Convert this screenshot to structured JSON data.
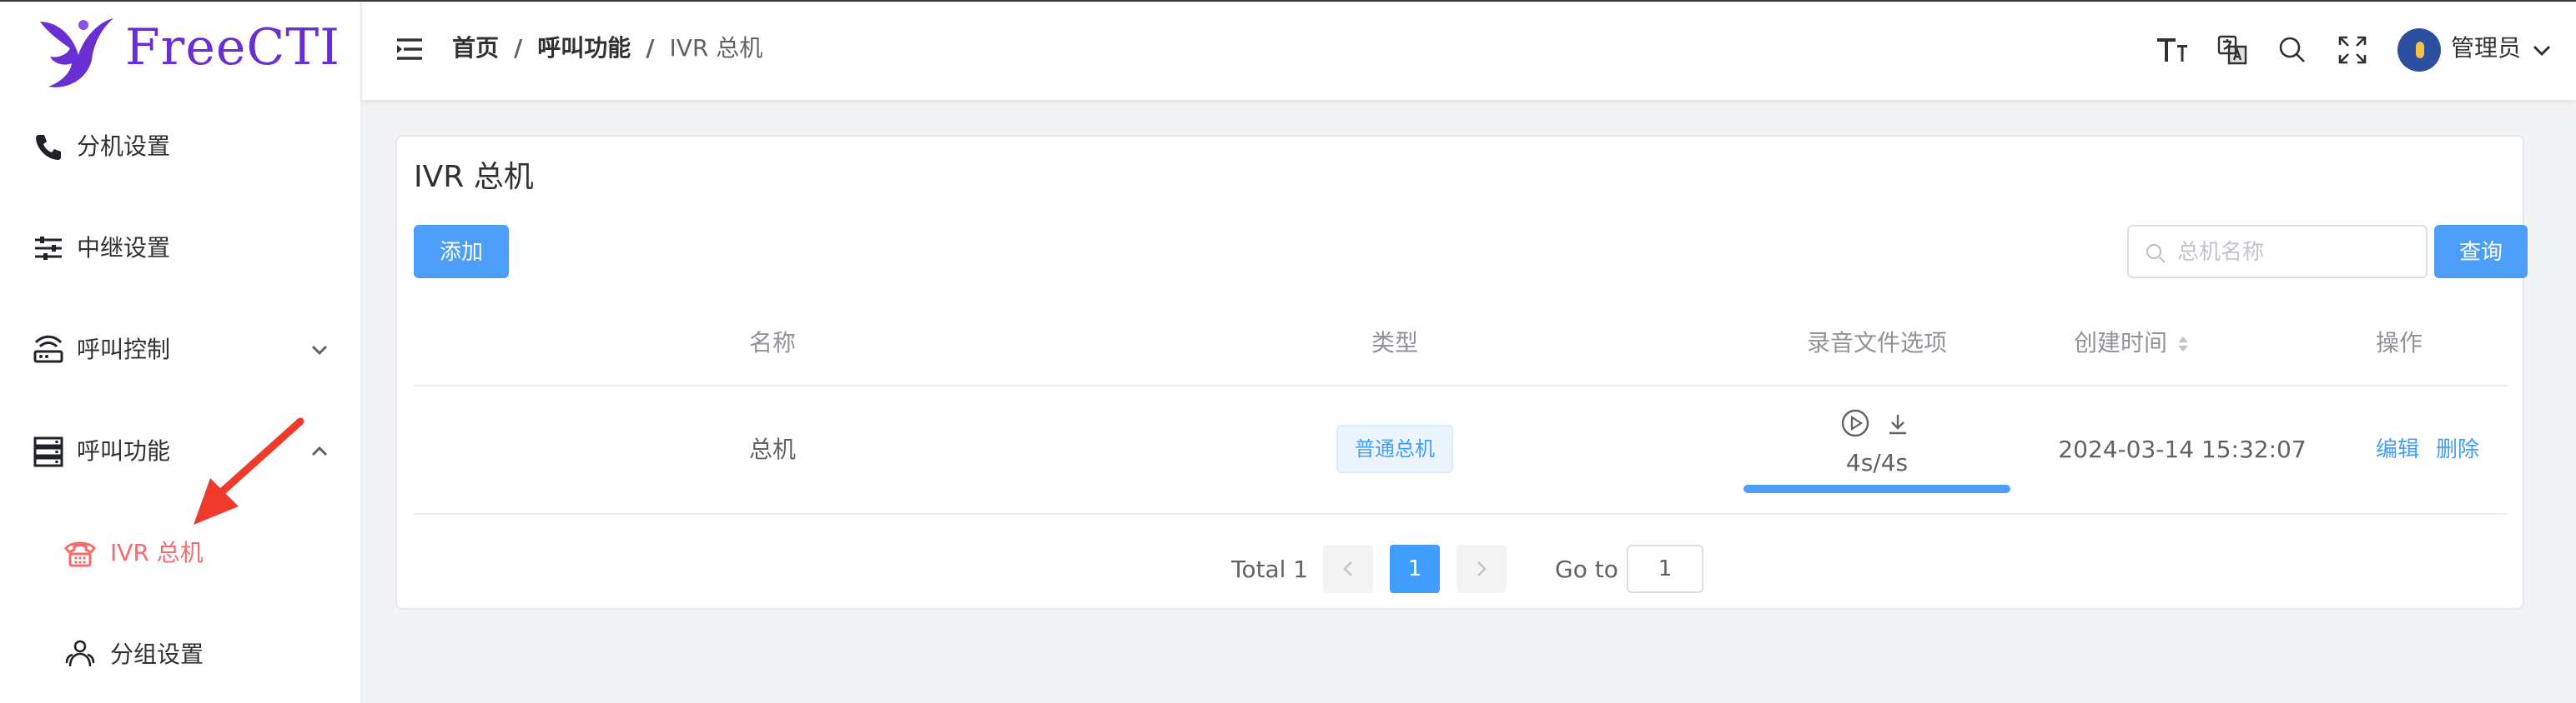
{
  "app": {
    "logo_text": "FreeCTI"
  },
  "sidebar": {
    "items": [
      {
        "label": "分机设置",
        "icon": "phone-icon"
      },
      {
        "label": "中继设置",
        "icon": "sliders-icon"
      },
      {
        "label": "呼叫控制",
        "icon": "router-icon",
        "expanded": false
      },
      {
        "label": "呼叫功能",
        "icon": "server-icon",
        "expanded": true
      },
      {
        "label": "IVR 总机",
        "icon": "telephone-icon",
        "active": true
      },
      {
        "label": "分组设置",
        "icon": "group-icon"
      }
    ]
  },
  "header": {
    "breadcrumb": [
      "首页",
      "呼叫功能",
      "IVR 总机"
    ],
    "separator": "/",
    "user_name": "管理员",
    "icons": [
      "font-size-icon",
      "translate-icon",
      "search-icon",
      "fullscreen-icon"
    ]
  },
  "page": {
    "title": "IVR 总机",
    "add_button": "添加",
    "search_placeholder": "总机名称",
    "search_value": "",
    "query_button": "查询"
  },
  "table": {
    "columns": [
      "名称",
      "类型",
      "录音文件选项",
      "创建时间",
      "操作"
    ],
    "rows": [
      {
        "name": "总机",
        "type": "普通总机",
        "recording_time": "4s/4s",
        "recording_progress": 1.0,
        "created_at": "2024-03-14 15:32:07",
        "actions": [
          "编辑",
          "删除"
        ]
      }
    ]
  },
  "pagination": {
    "total_label": "Total 1",
    "current_page": "1",
    "goto_label": "Go to",
    "goto_value": "1"
  },
  "colors": {
    "primary": "#409eff",
    "active_menu": "#f56c6c",
    "logo": "#6a2fd2",
    "annotation": "#f03a2e"
  }
}
